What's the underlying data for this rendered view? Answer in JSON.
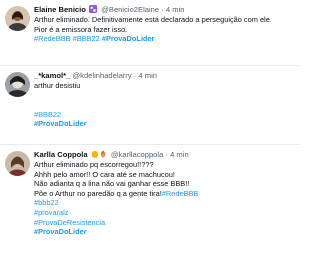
{
  "tweets": [
    {
      "name": "Elaine Benicio",
      "handle": "@Benicio2Elaine",
      "dot": "·",
      "time": "4 min",
      "lines": [
        "Arthur eliminado. Definitivamente está declarado a perseguição com ele.",
        "Pior é a emissora fazer isso."
      ],
      "tags": [
        "#RedeBBB",
        "#BBB22",
        "#ProvaDoLider"
      ]
    },
    {
      "name": "_*kamol*_",
      "handle": "@kdelinhadelarry",
      "dot": "·",
      "time": "4 min",
      "lines": [
        "arthur desistiu"
      ],
      "tags": [
        "#BBB22",
        "#ProvaDoLider"
      ]
    },
    {
      "name": "Karlla Coppola",
      "handle": "@karllacoppola",
      "dot": "·",
      "time": "4 min",
      "lines": [
        "Arthur eliminado pq escorregou!!???",
        "Ahhh pelo amor!! O cara até se machucou!",
        "Não adianta q a lina não vai ganhar esse BBB!!",
        "Põe o Arthur no paredão q a gente tira!"
      ],
      "inline_tag": "#RedeBBB",
      "tags": [
        "#bbb22",
        "#provaralz",
        "#ProvaDeResistencia",
        "#ProvaDoLider"
      ]
    }
  ],
  "colors": {
    "link": "#1d9bf0",
    "muted": "#536471",
    "text": "#0f1419",
    "divider": "#e6ecf0"
  },
  "icons": {
    "badge_1": "purple-shapes-emoji-icon",
    "badge_3": "hand-fire-emoji-icon"
  }
}
